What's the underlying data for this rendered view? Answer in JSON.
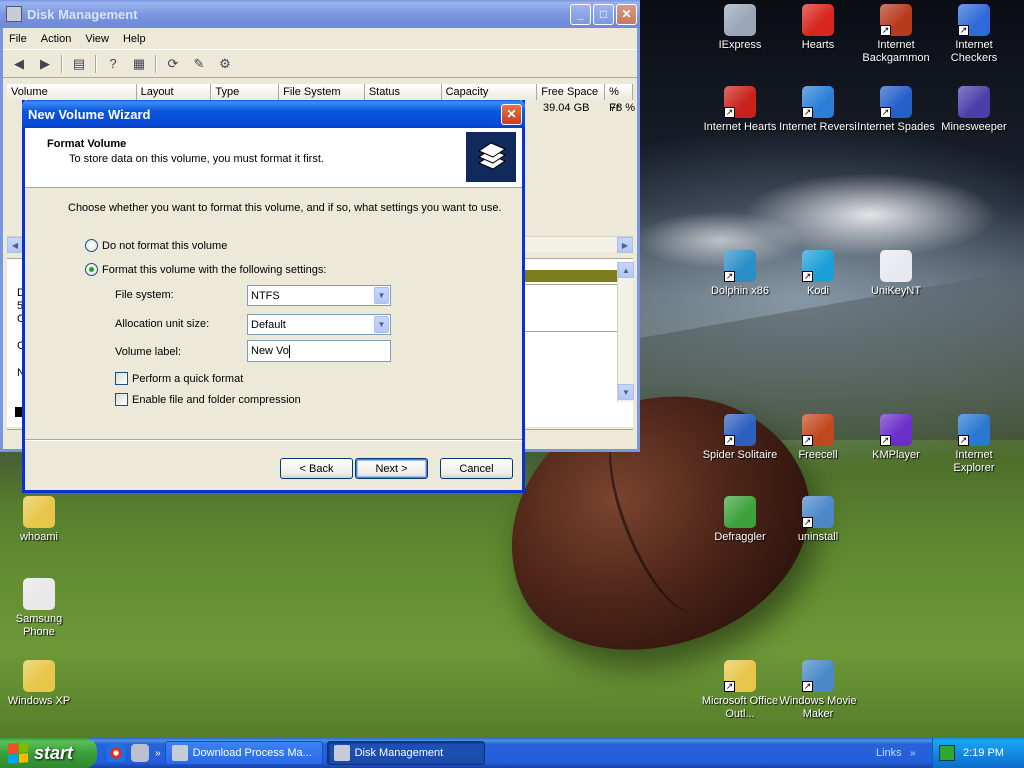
{
  "desktop": {
    "icons": [
      {
        "label": "IExpress",
        "color": "#9aa6b8"
      },
      {
        "label": "Hearts",
        "color": "#d8261d"
      },
      {
        "label": "Internet Backgammon",
        "color": "#b63a1d"
      },
      {
        "label": "Internet Checkers",
        "color": "#2f6ad8"
      },
      {
        "label": "Internet Hearts",
        "color": "#c8221b"
      },
      {
        "label": "Internet Reversi",
        "color": "#2a7fd8"
      },
      {
        "label": "Internet Spades",
        "color": "#2460c8"
      },
      {
        "label": "Minesweeper",
        "color": "#4b3ea8"
      },
      {
        "label": "Dolphin x86",
        "color": "#2a8fc8"
      },
      {
        "label": "Kodi",
        "color": "#1ba0d8"
      },
      {
        "label": "UniKeyNT",
        "color": "#e8e8f0"
      },
      {
        "label": "Spider Solitaire",
        "color": "#2d5fbf"
      },
      {
        "label": "Freecell",
        "color": "#c0481d"
      },
      {
        "label": "KMPlayer",
        "color": "#6a2fc8"
      },
      {
        "label": "Internet Explorer",
        "color": "#2a78d0"
      },
      {
        "label": "Defraggler",
        "color": "#3da23d"
      },
      {
        "label": "uninstall",
        "color": "#4c88c8"
      },
      {
        "label": "whoami",
        "color": "#e8c64a"
      },
      {
        "label": "Samsung Phone",
        "color": "#e8e8e8"
      },
      {
        "label": "Windows XP",
        "color": "#e8c64a"
      },
      {
        "label": "Microsoft Office Outl...",
        "color": "#e8c64a"
      },
      {
        "label": "Windows Movie Maker",
        "color": "#4a88c8"
      }
    ]
  },
  "disk_management": {
    "title": "Disk Management",
    "menu": [
      "File",
      "Action",
      "View",
      "Help"
    ],
    "columns": [
      "Volume",
      "Layout",
      "Type",
      "File System",
      "Status",
      "Capacity",
      "Free Space",
      "% Fr"
    ],
    "row": {
      "free_space": "39.04 GB",
      "percent_free": "78 %"
    },
    "lower_fragments": [
      "D",
      "5(",
      "O",
      "C",
      "N"
    ]
  },
  "wizard": {
    "title": "New Volume Wizard",
    "header_title": "Format Volume",
    "header_subtitle": "To store data on this volume, you must format it first.",
    "intro": "Choose whether you want to format this volume, and if so, what settings you want to use.",
    "option_no_format": "Do not format this volume",
    "option_format": "Format this volume with the following settings:",
    "file_system_label": "File system:",
    "file_system_value": "NTFS",
    "alloc_label": "Allocation unit size:",
    "alloc_value": "Default",
    "volume_label_label": "Volume label:",
    "volume_label_value": "New Vo",
    "quick_format": "Perform a quick format",
    "compression": "Enable file and folder compression",
    "back": "< Back",
    "next": "Next >",
    "cancel": "Cancel"
  },
  "taskbar": {
    "start": "start",
    "tasks": [
      {
        "label": "Download Process Ma..."
      },
      {
        "label": "Disk Management"
      }
    ],
    "links": "Links",
    "clock": "2:19 PM"
  },
  "colors": {
    "xp_blue": "#0831d9",
    "start_green": "#3a9e3a",
    "window_bg": "#ece9d8"
  }
}
